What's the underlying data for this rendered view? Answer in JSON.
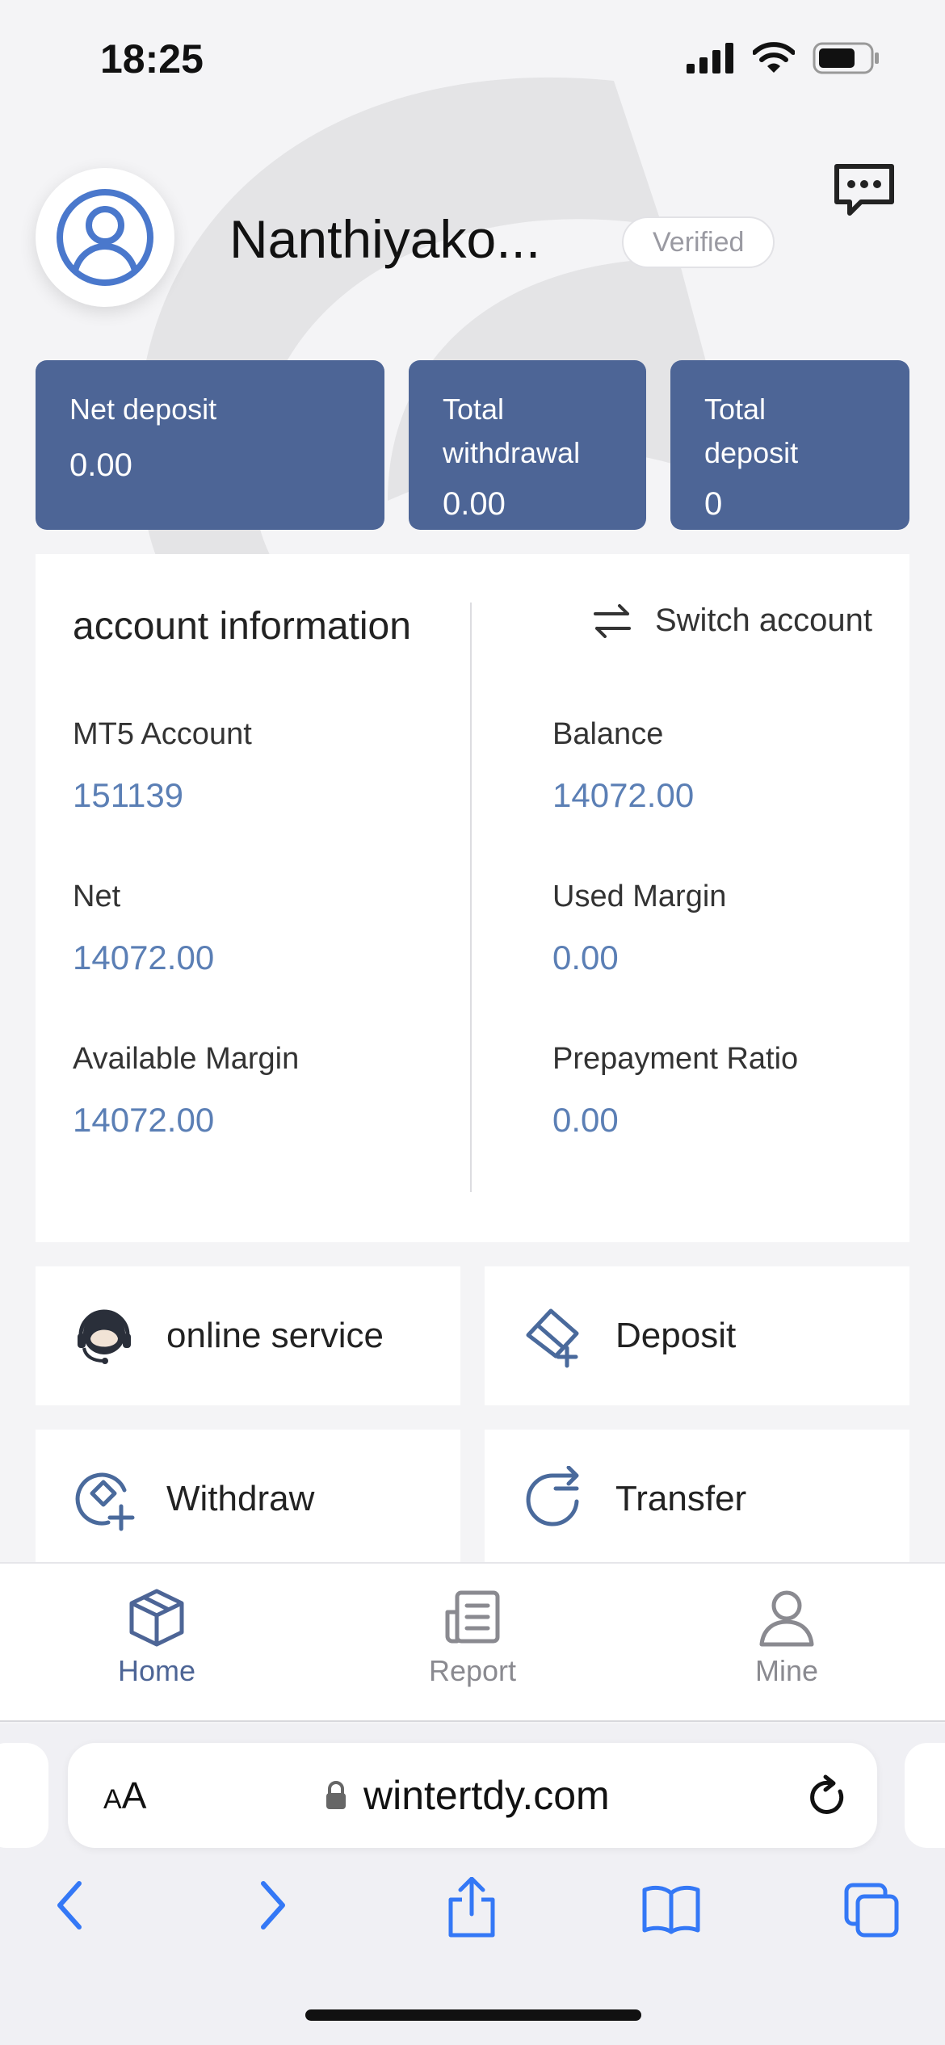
{
  "status_bar": {
    "time": "18:25"
  },
  "header": {
    "user_name": "Nanthiyako...",
    "verified_label": "Verified"
  },
  "stats": [
    {
      "label": "Net deposit",
      "value": "0.00"
    },
    {
      "label": "Total withdrawal",
      "value": "0.00"
    },
    {
      "label": "Total deposit",
      "value": "0"
    }
  ],
  "account": {
    "title": "account information",
    "switch_label": "Switch account",
    "fields": [
      {
        "label": "MT5 Account",
        "value": "151139"
      },
      {
        "label": "Balance",
        "value": "14072.00"
      },
      {
        "label": "Net",
        "value": "14072.00"
      },
      {
        "label": "Used Margin",
        "value": "0.00"
      },
      {
        "label": "Available Margin",
        "value": "14072.00"
      },
      {
        "label": "Prepayment Ratio",
        "value": "0.00"
      }
    ]
  },
  "actions": [
    {
      "label": "online service",
      "icon": "headset-icon"
    },
    {
      "label": "Deposit",
      "icon": "card-plus-icon"
    },
    {
      "label": "Withdraw",
      "icon": "withdraw-icon"
    },
    {
      "label": "Transfer",
      "icon": "transfer-icon"
    }
  ],
  "tabs": [
    {
      "label": "Home",
      "icon": "cube-icon",
      "active": true
    },
    {
      "label": "Report",
      "icon": "report-icon",
      "active": false
    },
    {
      "label": "Mine",
      "icon": "person-icon",
      "active": false
    }
  ],
  "browser": {
    "aa_small": "A",
    "aa_large": "A",
    "url": "wintertdy.com"
  },
  "colors": {
    "card_blue": "#4d6596",
    "value_blue": "#5b7fb5",
    "tab_active": "#4d6596",
    "tab_inactive": "#8a8a90",
    "ios_blue": "#3478f6"
  }
}
